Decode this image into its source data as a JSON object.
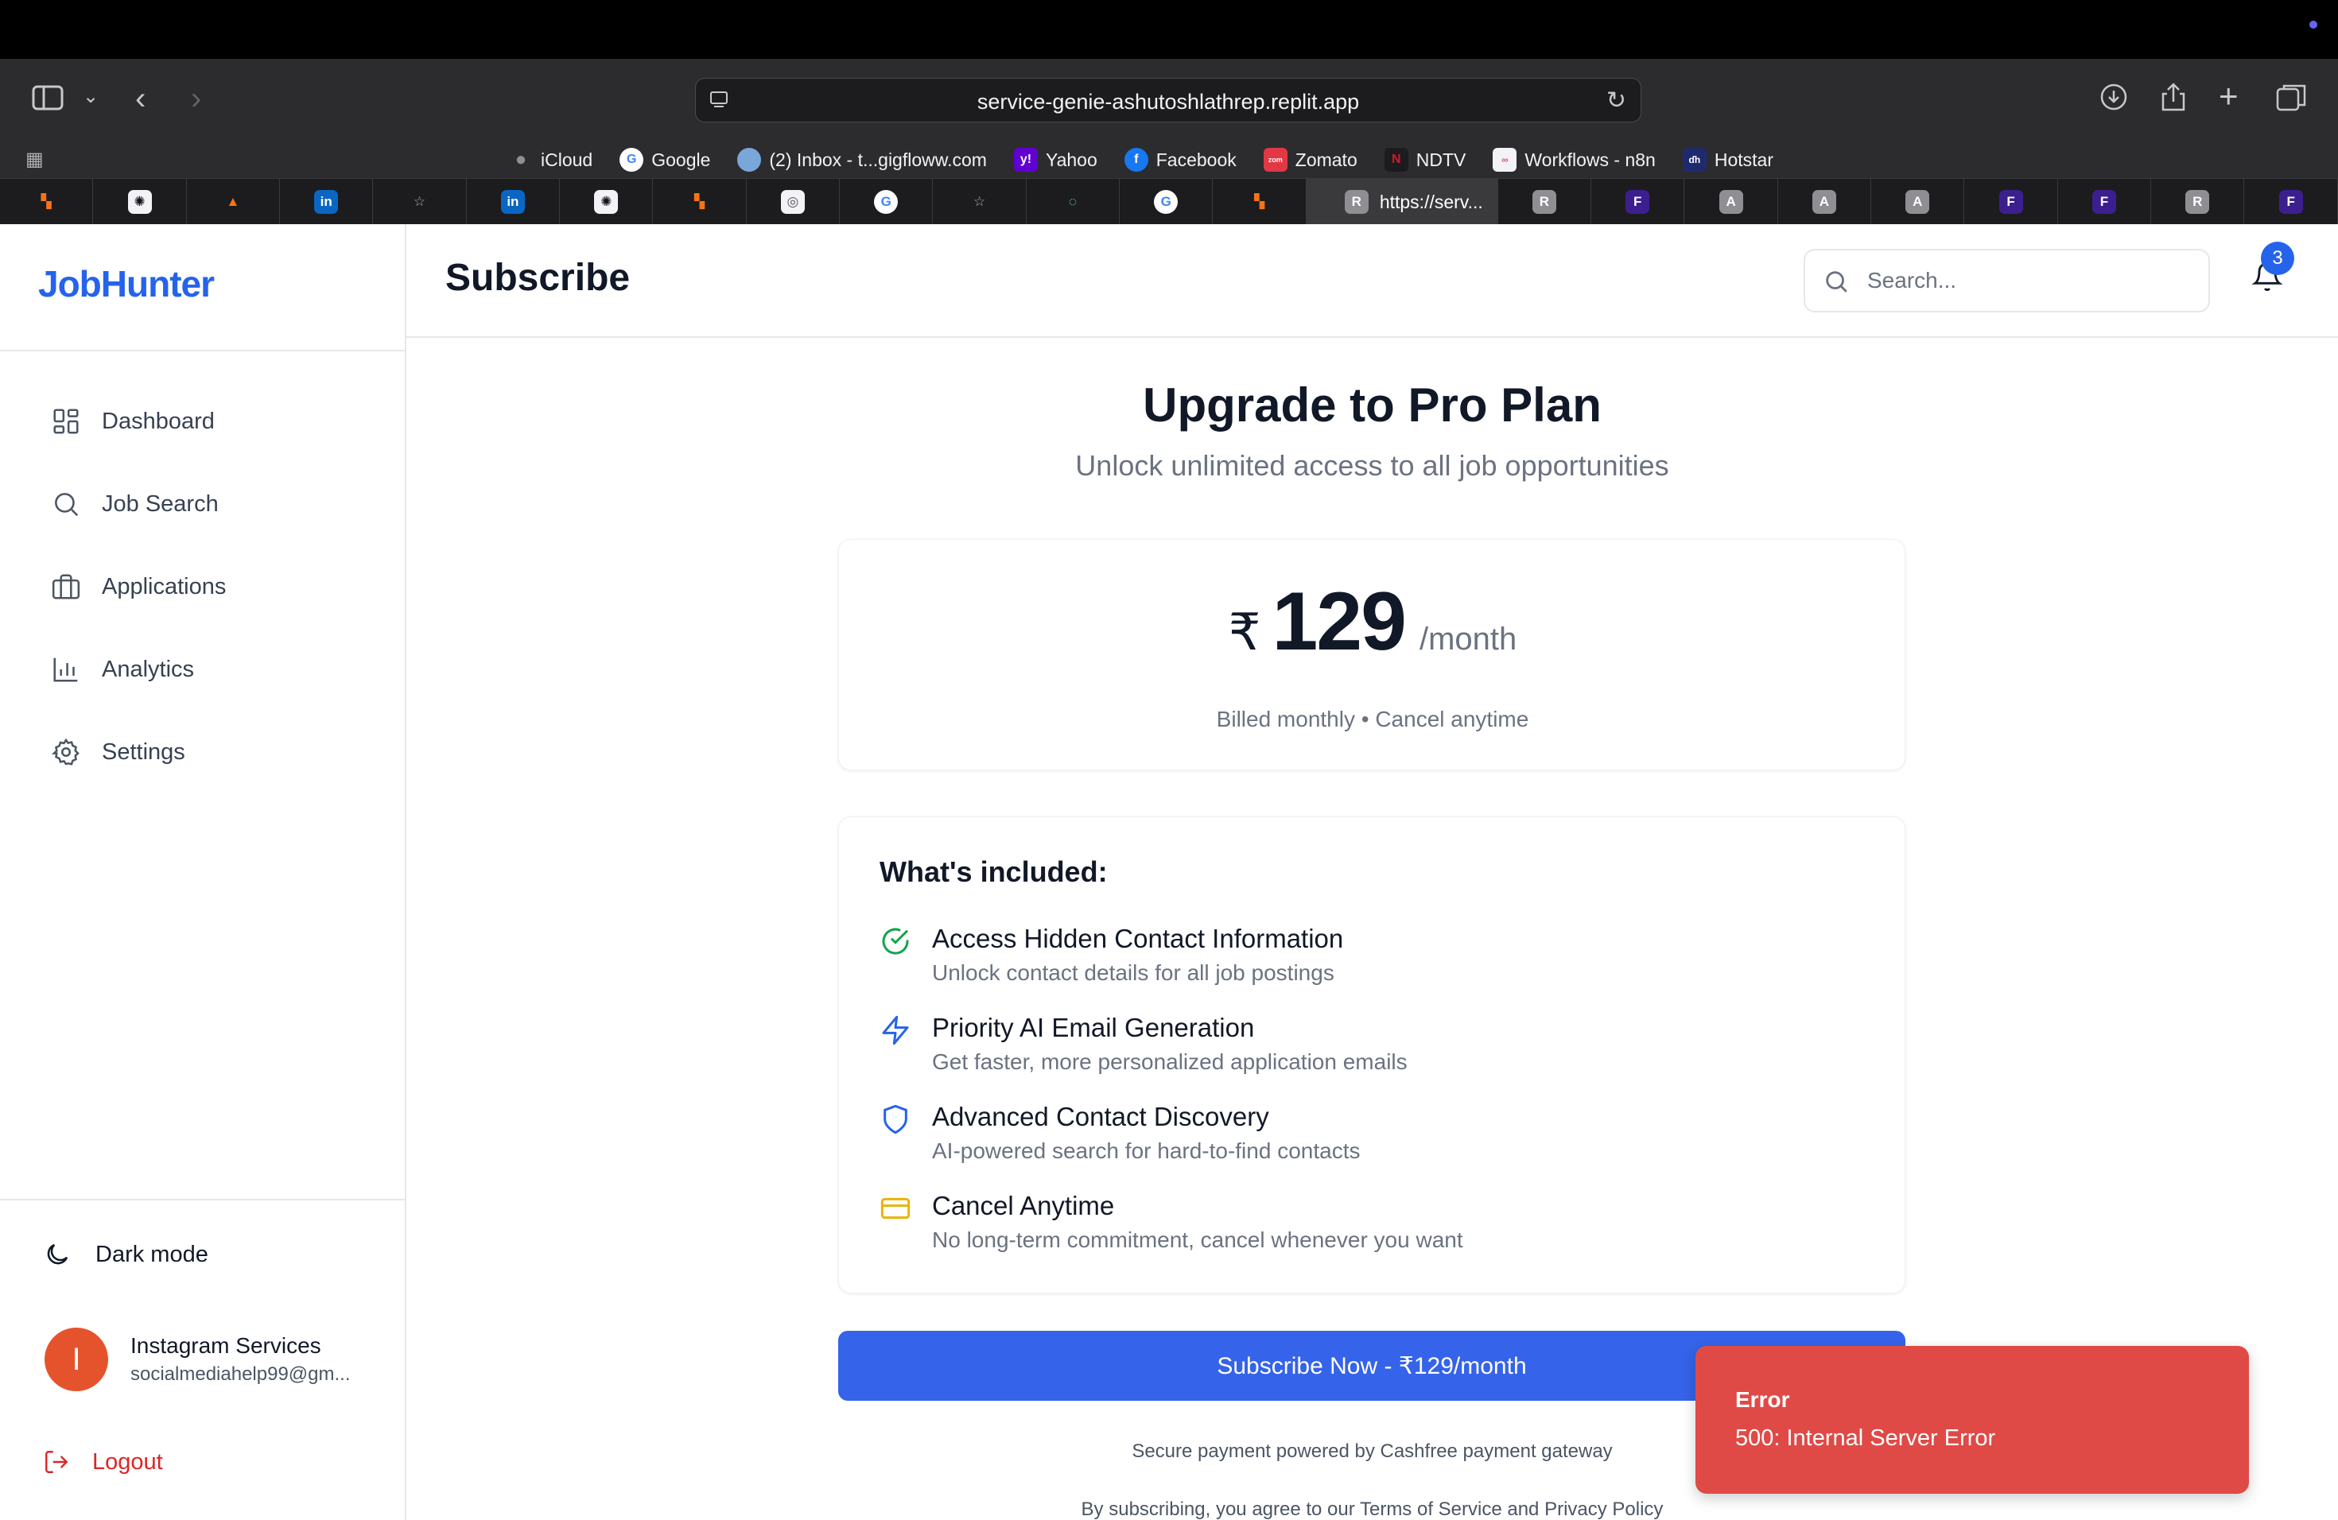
{
  "browser": {
    "url": "service-genie-ashutoshlathrep.replit.app",
    "bookmarks": [
      {
        "label": "iCloud",
        "icon": "apple-icon",
        "color": "#8e8e93"
      },
      {
        "label": "Google",
        "icon": "google-icon",
        "color": "#ffffff"
      },
      {
        "label": "(2) Inbox - t...gigfloww.com",
        "icon": "inbox-icon",
        "color": "#7aa7d9"
      },
      {
        "label": "Yahoo",
        "icon": "yahoo-icon",
        "color": "#6001d2"
      },
      {
        "label": "Facebook",
        "icon": "facebook-icon",
        "color": "#1877f2"
      },
      {
        "label": "Zomato",
        "icon": "zomato-icon",
        "color": "#e23744"
      },
      {
        "label": "NDTV",
        "icon": "ndtv-icon",
        "color": "#d3192b"
      },
      {
        "label": "Workflows - n8n",
        "icon": "n8n-icon",
        "color": "#ea4b71"
      },
      {
        "label": "Hotstar",
        "icon": "hotstar-icon",
        "color": "#1f2a6e"
      }
    ],
    "active_tab_label": "https://serv..."
  },
  "app": {
    "logo": "JobHunter",
    "nav": [
      {
        "label": "Dashboard",
        "icon": "dashboard-icon"
      },
      {
        "label": "Job Search",
        "icon": "search-icon"
      },
      {
        "label": "Applications",
        "icon": "briefcase-icon"
      },
      {
        "label": "Analytics",
        "icon": "bar-chart-icon"
      },
      {
        "label": "Settings",
        "icon": "gear-icon"
      }
    ],
    "dark_mode_label": "Dark mode",
    "user": {
      "initial": "I",
      "name": "Instagram Services",
      "email": "socialmediahelp99@gm..."
    },
    "logout_label": "Logout"
  },
  "header": {
    "title": "Subscribe",
    "search_placeholder": "Search...",
    "notification_count": "3"
  },
  "plan": {
    "title": "Upgrade to Pro Plan",
    "subtitle": "Unlock unlimited access to all job opportunities",
    "currency": "₹",
    "price": "129",
    "period": "/month",
    "billing": "Billed monthly • Cancel anytime",
    "features_title": "What's included:",
    "features": [
      {
        "title": "Access Hidden Contact Information",
        "desc": "Unlock contact details for all job postings",
        "icon": "check-circle-icon",
        "color": "#16a34a"
      },
      {
        "title": "Priority AI Email Generation",
        "desc": "Get faster, more personalized application emails",
        "icon": "lightning-icon",
        "color": "#2563eb"
      },
      {
        "title": "Advanced Contact Discovery",
        "desc": "AI-powered search for hard-to-find contacts",
        "icon": "shield-icon",
        "color": "#2563eb"
      },
      {
        "title": "Cancel Anytime",
        "desc": "No long-term commitment, cancel whenever you want",
        "icon": "credit-card-icon",
        "color": "#eab308"
      }
    ],
    "subscribe_button": "Subscribe Now - ₹129/month",
    "secure_note": "Secure payment powered by Cashfree payment gateway",
    "terms_note": "By subscribing, you agree to our Terms of Service and Privacy Policy"
  },
  "toast": {
    "title": "Error",
    "message": "500: Internal Server Error",
    "color": "#e04a46"
  }
}
